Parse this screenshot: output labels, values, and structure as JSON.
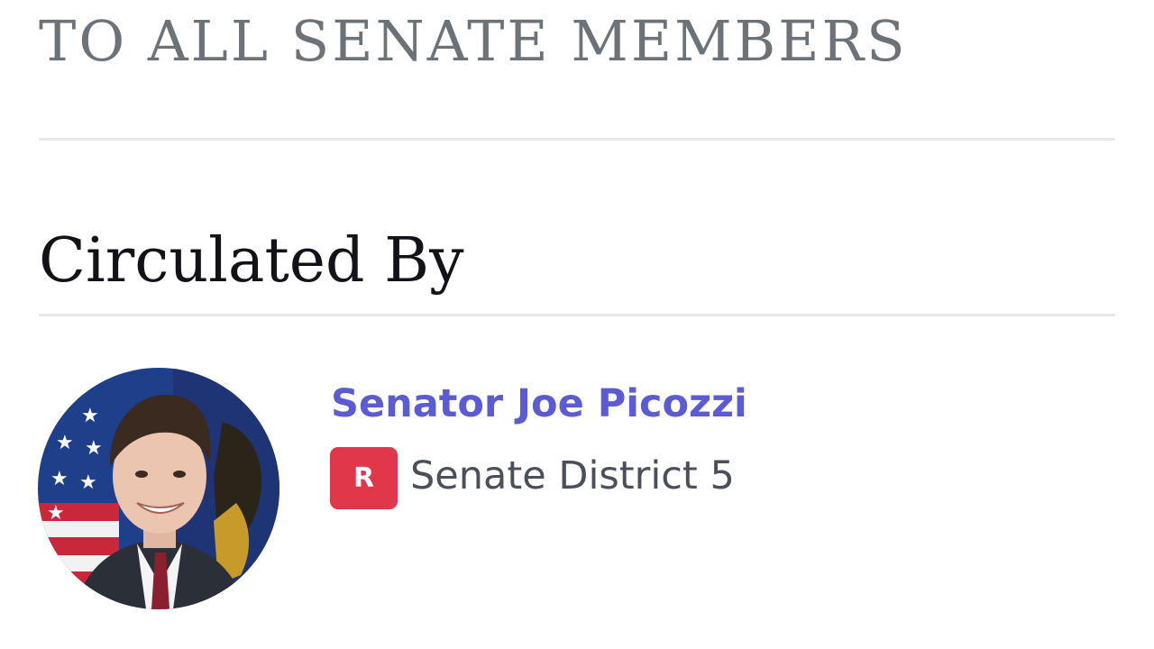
{
  "header": {
    "title": "TO ALL SENATE MEMBERS"
  },
  "circulated_by": {
    "heading": "Circulated By",
    "sponsor": {
      "name": "Senator Joe Picozzi",
      "party": "R",
      "district": "Senate District 5",
      "name_color": "#5b5bd6",
      "party_color": "#e0384a"
    }
  }
}
